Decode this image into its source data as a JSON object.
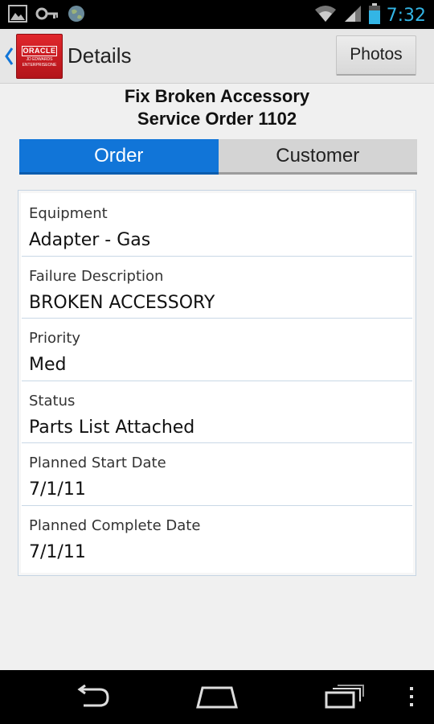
{
  "status_bar": {
    "time": "7:32",
    "icons": [
      "gallery-icon",
      "key-icon",
      "globe-icon",
      "wifi-icon",
      "signal-icon",
      "battery-icon"
    ]
  },
  "action_bar": {
    "title": "Details",
    "logo_text": [
      "ORACLE",
      "JD EDWARDS",
      "ENTERPRISEONE"
    ],
    "photos_label": "Photos"
  },
  "header": {
    "line1": "Fix Broken Accessory",
    "line2": "Service Order 1102"
  },
  "tabs": [
    {
      "label": "Order",
      "active": true
    },
    {
      "label": "Customer",
      "active": false
    }
  ],
  "details": [
    {
      "label": "Equipment",
      "value": "Adapter - Gas"
    },
    {
      "label": "Failure Description",
      "value": "BROKEN ACCESSORY"
    },
    {
      "label": "Priority",
      "value": "Med"
    },
    {
      "label": "Status",
      "value": "Parts List Attached"
    },
    {
      "label": "Planned Start Date",
      "value": "7/1/11"
    },
    {
      "label": "Planned Complete Date",
      "value": "7/1/11"
    }
  ],
  "nav": {
    "icons": [
      "back-icon",
      "home-icon",
      "recent-apps-icon",
      "overflow-menu-icon"
    ]
  },
  "colors": {
    "accent": "#1175d8",
    "status_blue": "#33b5e5",
    "oracle_red": "#d4202a"
  }
}
